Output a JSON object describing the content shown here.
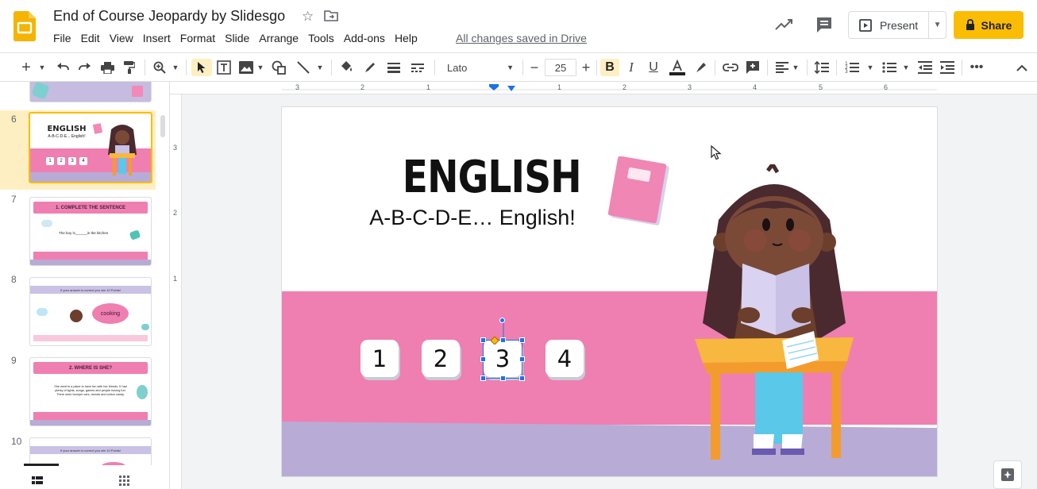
{
  "app": {
    "title": "End of Course Jeopardy by Slidesgo",
    "save_status": "All changes saved in Drive",
    "present_label": "Present",
    "share_label": "Share",
    "menu": [
      "File",
      "Edit",
      "View",
      "Insert",
      "Format",
      "Slide",
      "Arrange",
      "Tools",
      "Add-ons",
      "Help"
    ]
  },
  "toolbar": {
    "font": "Lato",
    "font_size": "25"
  },
  "sidebar": {
    "slides": [
      {
        "number": "6",
        "title": "ENGLISH",
        "subtitle": "A-B-C-D-E... English!",
        "buttons": [
          "1",
          "2",
          "3",
          "4"
        ]
      },
      {
        "number": "7",
        "title": "1. COMPLETE THE SENTENCE",
        "body": "The boy is______in the kitchen"
      },
      {
        "number": "8",
        "header": "If your answer is correct you win 10 Points!",
        "bubble": "cooking"
      },
      {
        "number": "9",
        "title": "2. WHERE IS SHE?",
        "body": "She went to a place to have fun with her friends. It had plenty of lights, songs, games and people having fun. There were bumper cars, donuts and cotton candy."
      },
      {
        "number": "10",
        "header": "If your answer is correct you win 10 Points!"
      }
    ]
  },
  "ruler": {
    "horizontal": [
      "3",
      "2",
      "1",
      "1",
      "2",
      "3",
      "4",
      "5",
      "6"
    ],
    "vertical": [
      "3",
      "2",
      "1"
    ]
  },
  "slide": {
    "title": "ENGLISH",
    "subtitle": "A-B-C-D-E… English!",
    "buttons": [
      "1",
      "2",
      "3",
      "4"
    ]
  },
  "colors": {
    "accent": "#fbbc04",
    "slide_pink": "#ef7fb0",
    "slide_purple": "#b8acd6",
    "selection": "#1a73e8"
  }
}
